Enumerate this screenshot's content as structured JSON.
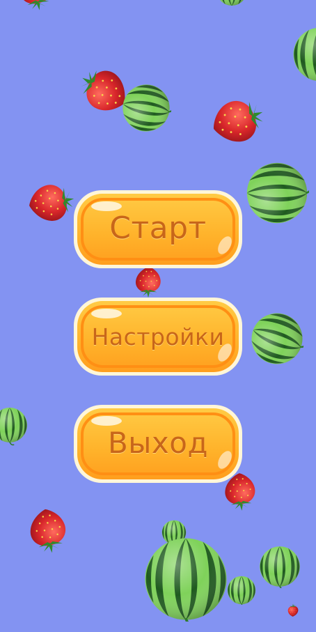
{
  "menu": {
    "start_label": "Старт",
    "settings_label": "Настройки",
    "exit_label": "Выход"
  },
  "colors": {
    "background": "#8393f2",
    "button_fill": "#ffb62e",
    "button_border": "#ff9a1a",
    "button_text": "#c8661a"
  },
  "icons": [
    "strawberry-icon",
    "watermelon-icon"
  ]
}
